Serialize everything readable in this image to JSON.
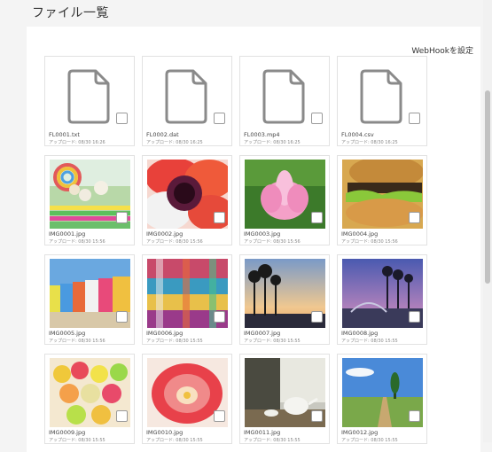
{
  "header": {
    "title": "ファイル一覧"
  },
  "toolbar": {
    "webhook_label": "WebHookを設定"
  },
  "files": [
    {
      "name": "FL0001.txt",
      "uploaded": "アップロード: 08/30 16:26",
      "kind": "file"
    },
    {
      "name": "FL0002.dat",
      "uploaded": "アップロード: 08/30 16:25",
      "kind": "file"
    },
    {
      "name": "FL0003.mp4",
      "uploaded": "アップロード: 08/30 16:25",
      "kind": "file"
    },
    {
      "name": "FL0004.csv",
      "uploaded": "アップロード: 08/30 16:25",
      "kind": "file"
    },
    {
      "name": "IMG0001.jpg",
      "uploaded": "アップロード: 08/30 15:56",
      "kind": "crayons"
    },
    {
      "name": "IMG0002.jpg",
      "uploaded": "アップロード: 08/30 15:56",
      "kind": "flower-red"
    },
    {
      "name": "IMG0003.jpg",
      "uploaded": "アップロード: 08/30 15:56",
      "kind": "lotus"
    },
    {
      "name": "IMG0004.jpg",
      "uploaded": "アップロード: 08/30 15:56",
      "kind": "burger"
    },
    {
      "name": "IMG0005.jpg",
      "uploaded": "アップロード: 08/30 15:56",
      "kind": "beach-huts"
    },
    {
      "name": "IMG0006.jpg",
      "uploaded": "アップロード: 08/30 15:55",
      "kind": "textiles"
    },
    {
      "name": "IMG0007.jpg",
      "uploaded": "アップロード: 08/30 15:55",
      "kind": "palms-sunset"
    },
    {
      "name": "IMG0008.jpg",
      "uploaded": "アップロード: 08/30 15:55",
      "kind": "plaza-palms"
    },
    {
      "name": "IMG0009.jpg",
      "uploaded": "アップロード: 08/30 15:55",
      "kind": "candies"
    },
    {
      "name": "IMG0010.jpg",
      "uploaded": "アップロード: 08/30 15:55",
      "kind": "tulip"
    },
    {
      "name": "IMG0011.jpg",
      "uploaded": "アップロード: 08/30 15:55",
      "kind": "teapot"
    },
    {
      "name": "IMG0012.jpg",
      "uploaded": "アップロード: 08/30 15:55",
      "kind": "field-tree"
    }
  ]
}
